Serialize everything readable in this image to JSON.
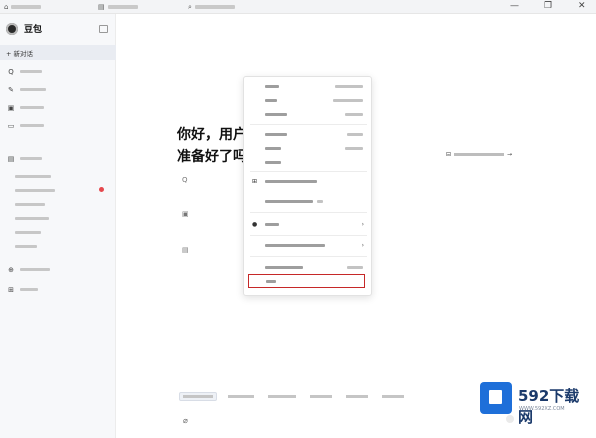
{
  "titlebar": {
    "minimize_glyph": "—",
    "restore_glyph": "❐",
    "close_glyph": "✕"
  },
  "sidebar": {
    "brand": "豆包",
    "new_chat": "+ 新对话"
  },
  "main": {
    "greeting_line1": "你好，用户",
    "greeting_line2": "准备好了吗"
  },
  "context_menu": {
    "items": []
  },
  "watermark": {
    "title": "592下载网",
    "sub": "WWW.592XZ.COM"
  },
  "colors": {
    "accent_red": "#c62828",
    "sidebar_bg": "#f7f8fa",
    "brand_blue": "#1e6fd9"
  }
}
